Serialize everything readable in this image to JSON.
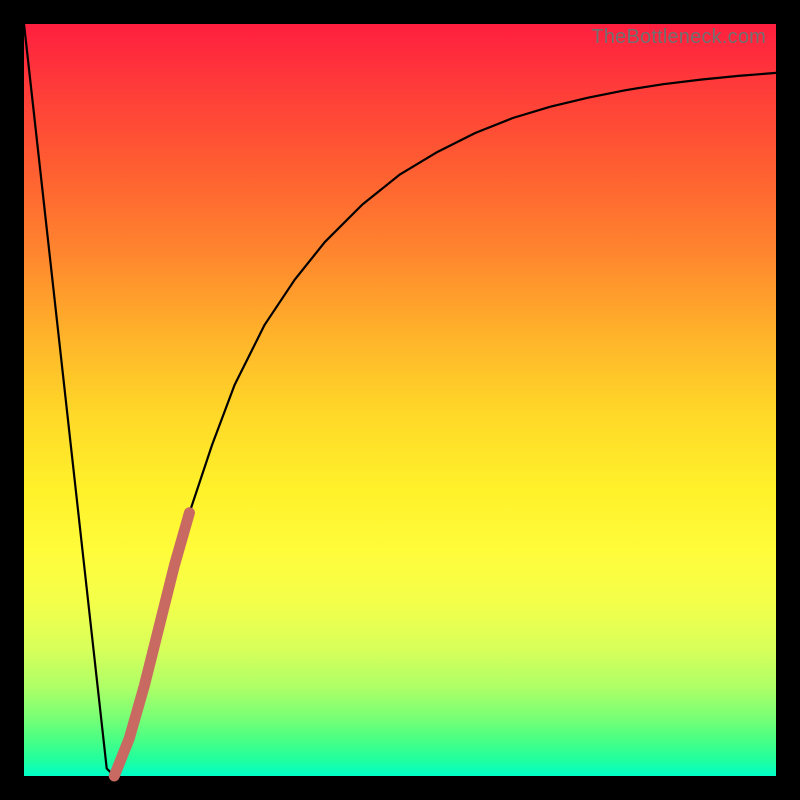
{
  "watermark": "TheBottleneck.com",
  "colors": {
    "curve": "#000000",
    "highlight": "#c96a62",
    "frame": "#000000"
  },
  "chart_data": {
    "type": "line",
    "title": "",
    "xlabel": "",
    "ylabel": "",
    "xlim": [
      0,
      100
    ],
    "ylim": [
      0,
      100
    ],
    "grid": false,
    "series": [
      {
        "name": "bottleneck-curve",
        "x": [
          0,
          2,
          4,
          6,
          8,
          10,
          11,
          12,
          13,
          14,
          16,
          18,
          20,
          22,
          25,
          28,
          32,
          36,
          40,
          45,
          50,
          55,
          60,
          65,
          70,
          75,
          80,
          85,
          90,
          95,
          100
        ],
        "values": [
          100,
          82,
          64,
          46,
          28,
          10,
          1,
          0,
          1.5,
          5,
          12,
          20,
          28,
          35,
          44,
          52,
          60,
          66,
          71,
          76,
          80,
          83,
          85.5,
          87.5,
          89,
          90.2,
          91.2,
          92,
          92.6,
          93.1,
          93.5
        ]
      },
      {
        "name": "highlight-segment",
        "x": [
          12,
          14,
          16,
          18,
          20,
          22
        ],
        "values": [
          0,
          5,
          12,
          20,
          28,
          35
        ]
      }
    ]
  }
}
